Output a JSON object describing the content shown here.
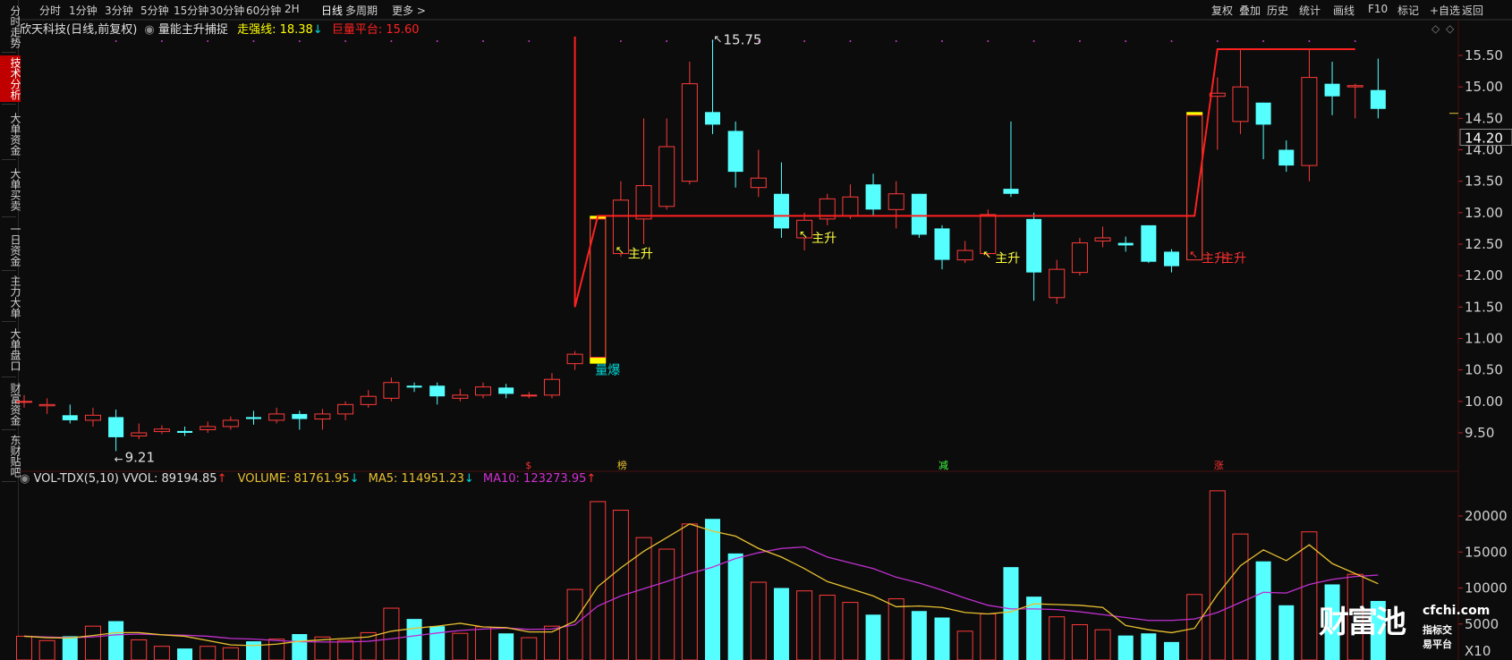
{
  "topbar": {
    "left_items": [
      "分时",
      "1分钟",
      "3分钟",
      "5分钟",
      "15分钟",
      "30分钟",
      "60分钟",
      "2H",
      "日线",
      "多周期",
      "更多 >"
    ],
    "active": "日线",
    "right_items": [
      "复权",
      "叠加",
      "历史",
      "统计",
      "画线",
      "F10",
      "标记",
      "+自选",
      "返回"
    ]
  },
  "sidebar": [
    "分时走势",
    "技术分析",
    "大单资金",
    "大单买卖",
    "一日资金",
    "主力大单",
    "大单盘口",
    "财富资金",
    "东财贴吧"
  ],
  "sidebar_active": "技术分析",
  "main_header": {
    "stock": "欣天科技(日线,前复权)",
    "indicator": "量能主升捕捉",
    "zqx_label": "走强线: 18.38",
    "jlpt_label": "巨量平台: 15.60",
    "colors": {
      "stock": "#e0e0e0",
      "indicator": "#e0e0e0",
      "zqx": "#ffff00",
      "jlpt": "#ff2020"
    }
  },
  "vol_header": {
    "name": "VOL-TDX(5,10)",
    "vvol": "VVOL: 89194.85",
    "volume": "VOLUME: 81761.95",
    "ma5": "MA5: 114951.23",
    "ma10": "MA10: 123273.95"
  },
  "price_axis": [
    "15.50",
    "15.00",
    "14.50",
    "14.00",
    "13.50",
    "13.00",
    "12.50",
    "12.00",
    "11.50",
    "11.00",
    "10.50",
    "10.00",
    "9.50"
  ],
  "current_price": "14.20",
  "vol_axis": [
    "20000",
    "15000",
    "10000",
    "5000"
  ],
  "vol_axis_unit": "X10",
  "annotations": {
    "high": "15.75",
    "low": "9.21",
    "signal_burst": "量爆",
    "signal_rise": "主升",
    "markers": [
      "$",
      "榜",
      "减",
      "涨"
    ]
  },
  "watermark": {
    "brand": "财富池",
    "domain": "cfchi.com",
    "slogan": "指标交易平台"
  },
  "chart_data": {
    "type": "candlestick",
    "candles": [
      {
        "o": 10.0,
        "c": 10.0,
        "h": 10.1,
        "l": 9.9,
        "v": 3300
      },
      {
        "o": 9.93,
        "c": 9.95,
        "h": 10.05,
        "l": 9.8,
        "v": 2700
      },
      {
        "o": 9.78,
        "c": 9.7,
        "h": 9.95,
        "l": 9.65,
        "v": 3300
      },
      {
        "o": 9.7,
        "c": 9.78,
        "h": 9.9,
        "l": 9.6,
        "v": 4700
      },
      {
        "o": 9.75,
        "c": 9.43,
        "h": 9.87,
        "l": 9.21,
        "v": 5400
      },
      {
        "o": 9.45,
        "c": 9.5,
        "h": 9.65,
        "l": 9.4,
        "v": 2800
      },
      {
        "o": 9.52,
        "c": 9.56,
        "h": 9.62,
        "l": 9.48,
        "v": 1900
      },
      {
        "o": 9.53,
        "c": 9.5,
        "h": 9.6,
        "l": 9.45,
        "v": 1600
      },
      {
        "o": 9.55,
        "c": 9.6,
        "h": 9.68,
        "l": 9.5,
        "v": 1900
      },
      {
        "o": 9.6,
        "c": 9.7,
        "h": 9.76,
        "l": 9.55,
        "v": 1700
      },
      {
        "o": 9.75,
        "c": 9.72,
        "h": 9.85,
        "l": 9.63,
        "v": 2600
      },
      {
        "o": 9.7,
        "c": 9.8,
        "h": 9.9,
        "l": 9.65,
        "v": 2900
      },
      {
        "o": 9.8,
        "c": 9.72,
        "h": 9.85,
        "l": 9.55,
        "v": 3600
      },
      {
        "o": 9.72,
        "c": 9.8,
        "h": 9.88,
        "l": 9.55,
        "v": 3200
      },
      {
        "o": 9.8,
        "c": 9.95,
        "h": 10.0,
        "l": 9.7,
        "v": 2700
      },
      {
        "o": 9.95,
        "c": 10.08,
        "h": 10.18,
        "l": 9.9,
        "v": 3800
      },
      {
        "o": 10.05,
        "c": 10.3,
        "h": 10.38,
        "l": 10.0,
        "v": 7200
      },
      {
        "o": 10.25,
        "c": 10.22,
        "h": 10.3,
        "l": 10.15,
        "v": 5700
      },
      {
        "o": 10.25,
        "c": 10.08,
        "h": 10.3,
        "l": 9.95,
        "v": 4700
      },
      {
        "o": 10.05,
        "c": 10.1,
        "h": 10.2,
        "l": 10.0,
        "v": 3700
      },
      {
        "o": 10.1,
        "c": 10.23,
        "h": 10.3,
        "l": 10.05,
        "v": 4600
      },
      {
        "o": 10.22,
        "c": 10.12,
        "h": 10.28,
        "l": 10.05,
        "v": 3700
      },
      {
        "o": 10.1,
        "c": 10.1,
        "h": 10.15,
        "l": 10.05,
        "v": 3100
      },
      {
        "o": 10.1,
        "c": 10.35,
        "h": 10.45,
        "l": 10.05,
        "v": 4700
      },
      {
        "o": 10.6,
        "c": 10.75,
        "h": 10.8,
        "l": 10.5,
        "v": 9800
      },
      {
        "o": 10.7,
        "c": 12.9,
        "h": 12.9,
        "l": 10.7,
        "v": 22000
      },
      {
        "o": 12.35,
        "c": 13.2,
        "h": 13.5,
        "l": 12.3,
        "v": 20800
      },
      {
        "o": 12.9,
        "c": 13.43,
        "h": 14.5,
        "l": 12.5,
        "v": 17000
      },
      {
        "o": 13.1,
        "c": 14.05,
        "h": 14.5,
        "l": 13.05,
        "v": 15400
      },
      {
        "o": 13.5,
        "c": 15.05,
        "h": 15.4,
        "l": 13.45,
        "v": 18900
      },
      {
        "o": 14.6,
        "c": 14.4,
        "h": 15.75,
        "l": 14.25,
        "v": 19600
      },
      {
        "o": 14.3,
        "c": 13.65,
        "h": 14.45,
        "l": 13.4,
        "v": 14800
      },
      {
        "o": 13.4,
        "c": 13.55,
        "h": 14.0,
        "l": 13.25,
        "v": 10800
      },
      {
        "o": 13.3,
        "c": 12.75,
        "h": 13.8,
        "l": 12.6,
        "v": 10000
      },
      {
        "o": 12.6,
        "c": 12.88,
        "h": 13.0,
        "l": 12.4,
        "v": 9600
      },
      {
        "o": 12.9,
        "c": 13.22,
        "h": 13.3,
        "l": 12.8,
        "v": 9000
      },
      {
        "o": 12.95,
        "c": 13.25,
        "h": 13.45,
        "l": 12.9,
        "v": 8000
      },
      {
        "o": 13.45,
        "c": 13.05,
        "h": 13.62,
        "l": 12.95,
        "v": 6300
      },
      {
        "o": 13.05,
        "c": 13.3,
        "h": 13.5,
        "l": 12.75,
        "v": 8500
      },
      {
        "o": 13.3,
        "c": 12.65,
        "h": 13.3,
        "l": 12.6,
        "v": 6800
      },
      {
        "o": 12.75,
        "c": 12.25,
        "h": 12.8,
        "l": 12.1,
        "v": 5900
      },
      {
        "o": 12.25,
        "c": 12.4,
        "h": 12.55,
        "l": 12.2,
        "v": 4000
      },
      {
        "o": 12.35,
        "c": 12.97,
        "h": 13.05,
        "l": 12.3,
        "v": 6400
      },
      {
        "o": 13.38,
        "c": 13.3,
        "h": 14.45,
        "l": 13.25,
        "v": 12900
      },
      {
        "o": 12.9,
        "c": 12.05,
        "h": 13.0,
        "l": 11.6,
        "v": 8800
      },
      {
        "o": 11.65,
        "c": 12.1,
        "h": 12.25,
        "l": 11.55,
        "v": 6000
      },
      {
        "o": 12.05,
        "c": 12.52,
        "h": 12.6,
        "l": 12.0,
        "v": 4900
      },
      {
        "o": 12.55,
        "c": 12.6,
        "h": 12.78,
        "l": 12.45,
        "v": 4200
      },
      {
        "o": 12.52,
        "c": 12.48,
        "h": 12.62,
        "l": 12.38,
        "v": 3400
      },
      {
        "o": 12.8,
        "c": 12.22,
        "h": 12.8,
        "l": 12.2,
        "v": 3700
      },
      {
        "o": 12.38,
        "c": 12.15,
        "h": 12.42,
        "l": 12.05,
        "v": 2500
      },
      {
        "o": 12.25,
        "c": 14.55,
        "h": 14.55,
        "l": 12.25,
        "v": 9100
      },
      {
        "o": 14.85,
        "c": 14.9,
        "h": 15.15,
        "l": 14.0,
        "v": 23500
      },
      {
        "o": 14.45,
        "c": 15.0,
        "h": 15.6,
        "l": 14.25,
        "v": 17500
      },
      {
        "o": 14.75,
        "c": 14.4,
        "h": 14.75,
        "l": 13.85,
        "v": 13700
      },
      {
        "o": 14.0,
        "c": 13.75,
        "h": 14.15,
        "l": 13.65,
        "v": 7600
      },
      {
        "o": 13.75,
        "c": 15.15,
        "h": 15.6,
        "l": 13.5,
        "v": 17800
      },
      {
        "o": 15.05,
        "c": 14.85,
        "h": 15.4,
        "l": 14.55,
        "v": 10500
      },
      {
        "o": 15.0,
        "c": 15.02,
        "h": 15.05,
        "l": 14.5,
        "v": 11900
      },
      {
        "o": 14.95,
        "c": 14.65,
        "h": 15.45,
        "l": 14.5,
        "v": 8200
      }
    ],
    "ma5": [
      3300,
      3100,
      3050,
      3400,
      3800,
      3800,
      3500,
      3300,
      2700,
      2100,
      2000,
      2200,
      2600,
      2800,
      3000,
      3200,
      4000,
      4400,
      4700,
      5100,
      4600,
      4500,
      3900,
      3900,
      5400,
      10200,
      12800,
      15100,
      17000,
      18900,
      17900,
      17200,
      15500,
      14300,
      12700,
      10900,
      9900,
      8900,
      7400,
      7500,
      7300,
      6600,
      6400,
      6700,
      7800,
      7700,
      7600,
      7300,
      4800,
      4200,
      3800,
      4400,
      9100,
      13100,
      15300,
      13800,
      16000,
      13400,
      12000,
      10600
    ],
    "ma10": [
      3300,
      3200,
      3100,
      3200,
      3500,
      3600,
      3500,
      3450,
      3300,
      3000,
      2900,
      2700,
      2550,
      2500,
      2500,
      2600,
      2950,
      3350,
      3750,
      4100,
      4300,
      4450,
      4250,
      4300,
      4900,
      7500,
      8900,
      9900,
      10900,
      12000,
      12900,
      14100,
      14900,
      15500,
      15700,
      14300,
      13500,
      12700,
      11500,
      10700,
      9700,
      8600,
      7600,
      7100,
      7100,
      7000,
      6700,
      6300,
      5900,
      5500,
      5500,
      5700,
      6600,
      8000,
      9400,
      9300,
      10500,
      11200,
      11600,
      11800
    ],
    "price_ylim": [
      9.25,
      15.85
    ],
    "vol_ylim": [
      0,
      23800
    ],
    "zqx_line": [
      {
        "i": 24,
        "y": 15.8
      },
      {
        "i": 24,
        "y": 11.5
      },
      {
        "i": 25,
        "y": 12.95
      },
      {
        "i": 51,
        "y": 12.95
      },
      {
        "i": 52,
        "y": 15.6
      },
      {
        "i": 58,
        "y": 15.6
      }
    ],
    "burst_bars": [
      {
        "i": 25,
        "top": 12.95,
        "bottom": 10.6
      },
      {
        "i": 51,
        "top": 14.6,
        "bottom": 12.25
      }
    ],
    "rise_signals": [
      26,
      34,
      42,
      51
    ],
    "burst_signal": 25
  }
}
